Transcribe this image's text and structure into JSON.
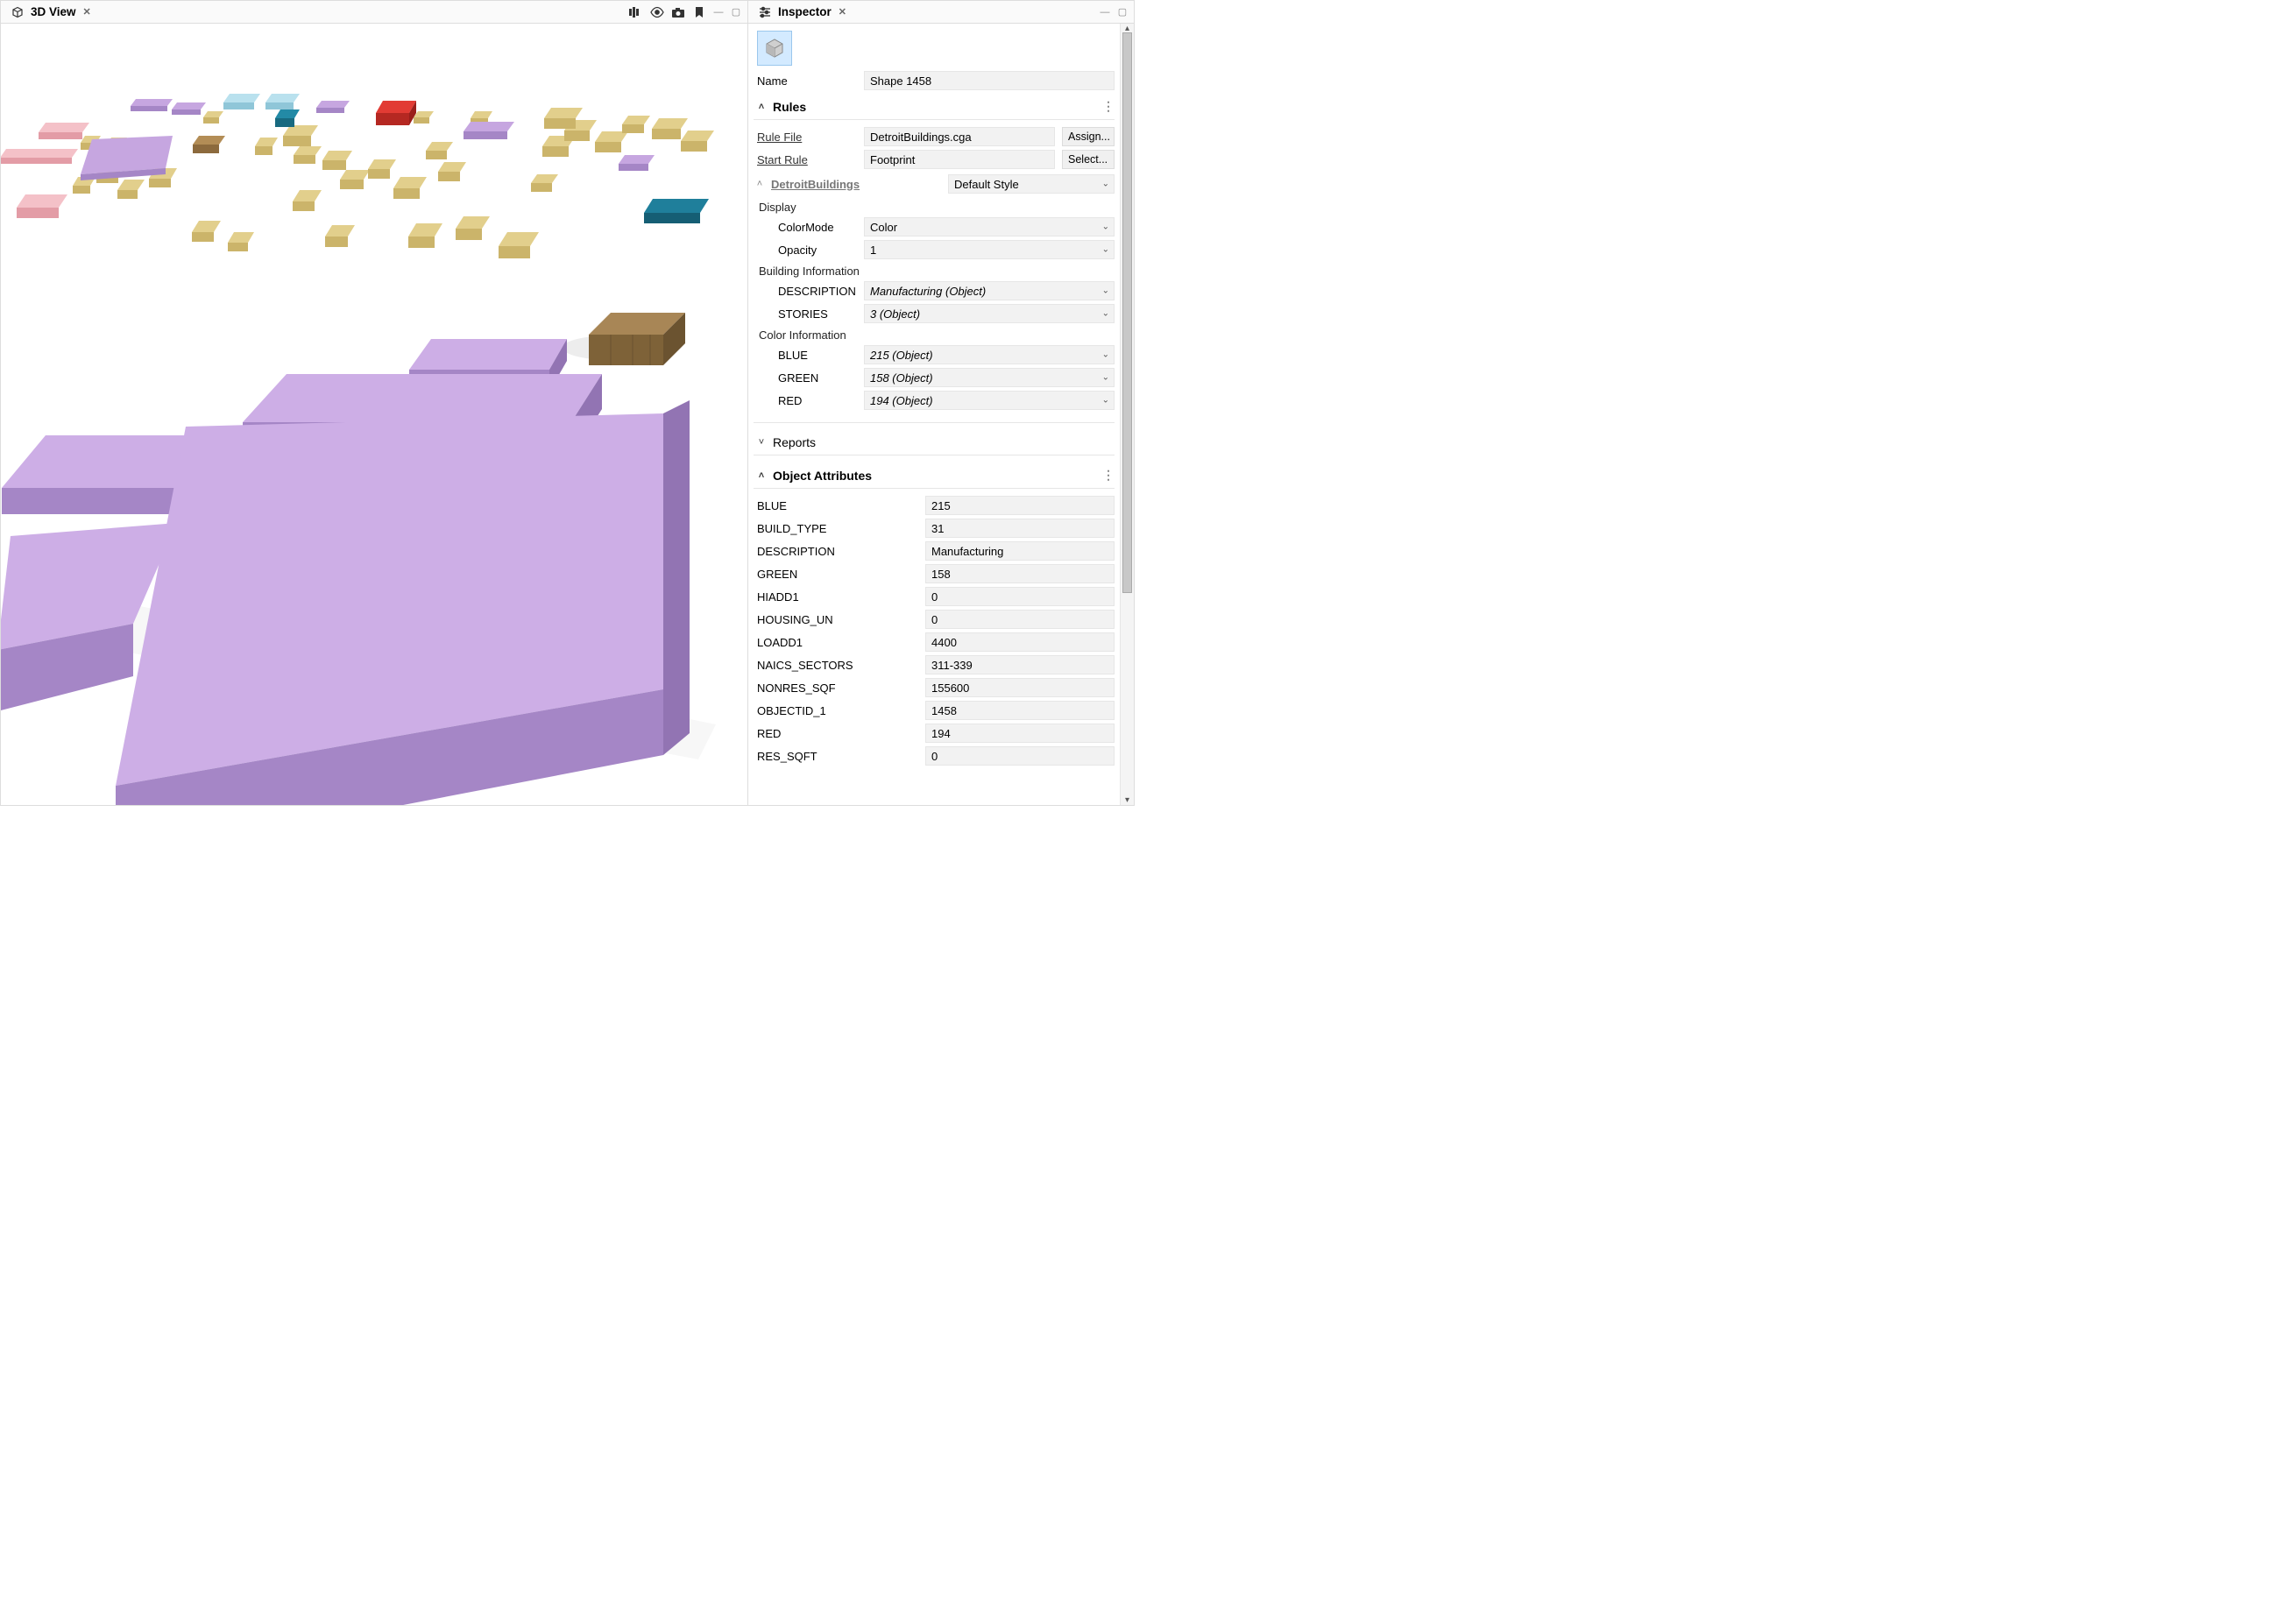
{
  "left_panel": {
    "tab_title": "3D View"
  },
  "inspector": {
    "tab_title": "Inspector",
    "name_label": "Name",
    "name_value": "Shape 1458",
    "rules": {
      "header": "Rules",
      "rule_file_label": "Rule File",
      "rule_file_value": "DetroitBuildings.cga",
      "assign_btn": "Assign...",
      "start_rule_label": "Start Rule",
      "start_rule_value": "Footprint",
      "select_btn": "Select...",
      "group_label": "DetroitBuildings",
      "style_value": "Default Style",
      "display_header": "Display",
      "colormode_label": "ColorMode",
      "colormode_value": "Color",
      "opacity_label": "Opacity",
      "opacity_value": "1",
      "building_info_header": "Building Information",
      "description_label": "DESCRIPTION",
      "description_value": "Manufacturing (Object)",
      "stories_label": "STORIES",
      "stories_value": "3 (Object)",
      "color_info_header": "Color Information",
      "blue_label": "BLUE",
      "blue_value": "215 (Object)",
      "green_label": "GREEN",
      "green_value": "158 (Object)",
      "red_label": "RED",
      "red_value": "194 (Object)"
    },
    "reports_header": "Reports",
    "obj_attr_header": "Object Attributes",
    "obj_attrs": [
      {
        "k": "BLUE",
        "v": "215"
      },
      {
        "k": "BUILD_TYPE",
        "v": "31"
      },
      {
        "k": "DESCRIPTION",
        "v": "Manufacturing"
      },
      {
        "k": "GREEN",
        "v": "158"
      },
      {
        "k": "HIADD1",
        "v": "0"
      },
      {
        "k": "HOUSING_UN",
        "v": "0"
      },
      {
        "k": "LOADD1",
        "v": "4400"
      },
      {
        "k": "NAICS_SECTORS",
        "v": "311-339"
      },
      {
        "k": "NONRES_SQF",
        "v": "155600"
      },
      {
        "k": "OBJECTID_1",
        "v": "1458"
      },
      {
        "k": "RED",
        "v": "194"
      },
      {
        "k": "RES_SQFT",
        "v": "0"
      }
    ]
  }
}
